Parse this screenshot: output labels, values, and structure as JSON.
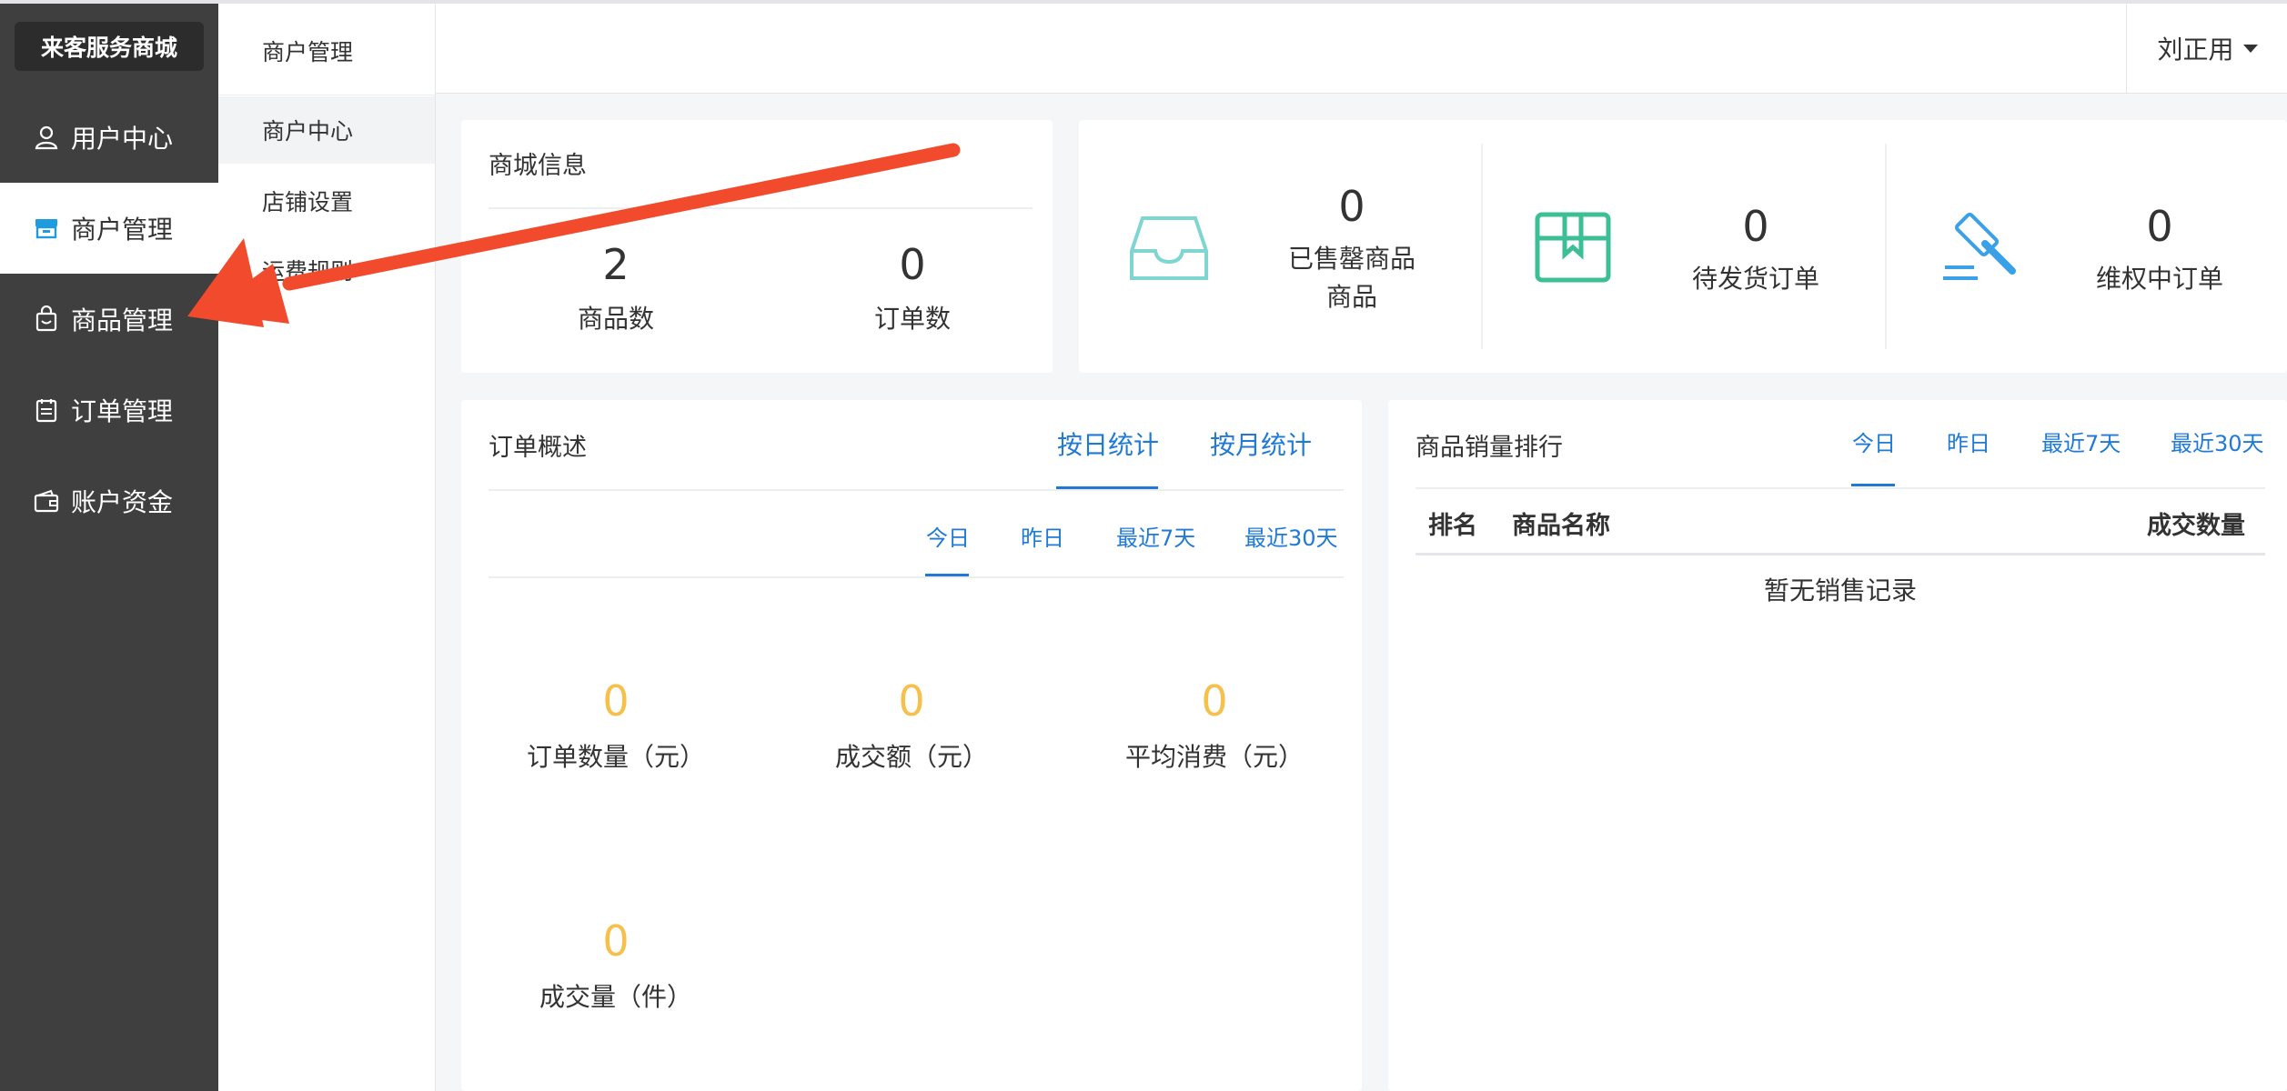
{
  "brand": "来客服务商城",
  "sidebar": {
    "items": [
      {
        "label": "用户中心",
        "icon": "user-icon"
      },
      {
        "label": "商户管理",
        "icon": "store-icon"
      },
      {
        "label": "商品管理",
        "icon": "bag-icon"
      },
      {
        "label": "订单管理",
        "icon": "clipboard-icon"
      },
      {
        "label": "账户资金",
        "icon": "wallet-icon"
      }
    ]
  },
  "submenu": {
    "title": "商户管理",
    "items": [
      {
        "label": "商户中心"
      },
      {
        "label": "店铺设置"
      },
      {
        "label": "运费规则"
      }
    ]
  },
  "header": {
    "user": "刘正用"
  },
  "mall_info": {
    "title": "商城信息",
    "goods_count": "2",
    "goods_label": "商品数",
    "order_count": "0",
    "order_label": "订单数"
  },
  "status_cards": [
    {
      "value": "0",
      "label_line1": "已售罄商品",
      "label_line2": "商品",
      "icon": "inbox-icon",
      "color": "#7fd6d0"
    },
    {
      "value": "0",
      "label": "待发货订单",
      "icon": "package-icon",
      "color": "#3dbf95"
    },
    {
      "value": "0",
      "label": "维权中订单",
      "icon": "gavel-icon",
      "color": "#3aa0e8"
    }
  ],
  "order_overview": {
    "title": "订单概述",
    "tabs": [
      "按日统计",
      "按月统计"
    ],
    "range_tabs": [
      "今日",
      "昨日",
      "最近7天",
      "最近30天"
    ],
    "stats": [
      {
        "value": "0",
        "label": "订单数量（元）"
      },
      {
        "value": "0",
        "label": "成交额（元）"
      },
      {
        "value": "0",
        "label": "平均消费（元）"
      },
      {
        "value": "0",
        "label": "成交量（件）"
      }
    ]
  },
  "ranking": {
    "title": "商品销量排行",
    "range_tabs": [
      "今日",
      "昨日",
      "最近7天",
      "最近30天"
    ],
    "columns": [
      "排名",
      "商品名称",
      "成交数量"
    ],
    "empty_text": "暂无销售记录"
  },
  "colors": {
    "sidebar_bg": "#3f3f3f",
    "accent_blue": "#1f7ad6",
    "stat_yellow": "#f5c04b",
    "arrow_red": "#f14a2c"
  }
}
